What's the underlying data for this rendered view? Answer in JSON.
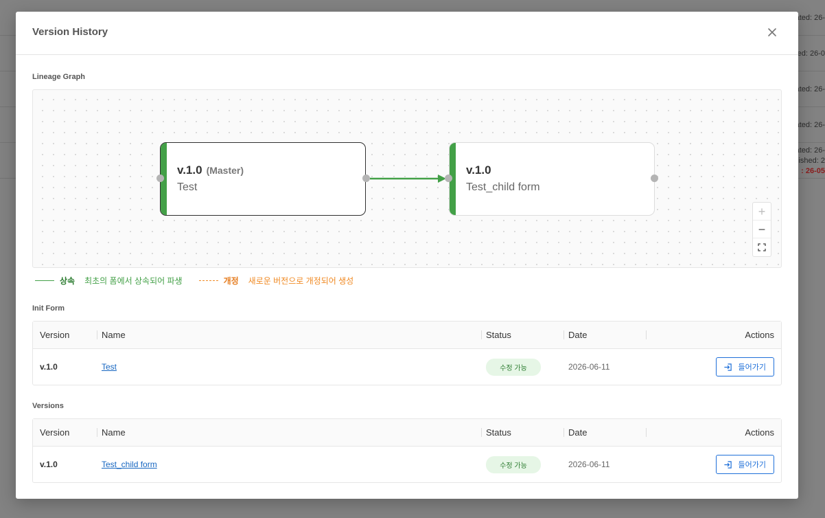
{
  "background": {
    "rows": [
      {
        "text": "ated: 26-"
      },
      {
        "text": "ated: 26-0"
      },
      {
        "text": "ated: 26-"
      },
      {
        "text": "ated: 26-"
      }
    ],
    "last_row": {
      "line1": "ated: 26-",
      "line2": "lished: 2",
      "line3": ": 26-05"
    }
  },
  "modal": {
    "title": "Version History",
    "close_icon": "close-icon"
  },
  "lineage": {
    "label": "Lineage Graph",
    "nodes": [
      {
        "version": "v.1.0",
        "tag": "(Master)",
        "name": "Test"
      },
      {
        "version": "v.1.0",
        "tag": "",
        "name": "Test_child form"
      }
    ],
    "edge_color": "#43a047",
    "controls": {
      "zoom_in": "+",
      "zoom_out": "−",
      "fit_icon": "fullscreen-icon"
    }
  },
  "legend": {
    "inherit_key": "상속",
    "inherit_desc": "최초의 폼에서 상속되어 파생",
    "revise_key": "개정",
    "revise_desc": "새로운 버전으로 개정되어 생성"
  },
  "init_form": {
    "label": "Init Form",
    "columns": [
      "Version",
      "Name",
      "Status",
      "Date",
      "Actions"
    ],
    "rows": [
      {
        "version": "v.1.0",
        "name": "Test",
        "status": "수정 가능",
        "date": "2026-06-11",
        "action": "들어가기"
      }
    ]
  },
  "versions": {
    "label": "Versions",
    "columns": [
      "Version",
      "Name",
      "Status",
      "Date",
      "Actions"
    ],
    "rows": [
      {
        "version": "v.1.0",
        "name": "Test_child form",
        "status": "수정 가능",
        "date": "2026-06-11",
        "action": "들어가기"
      }
    ]
  },
  "colors": {
    "accent_green": "#43a047",
    "accent_orange": "#f08a24",
    "link_blue": "#1565c0"
  }
}
